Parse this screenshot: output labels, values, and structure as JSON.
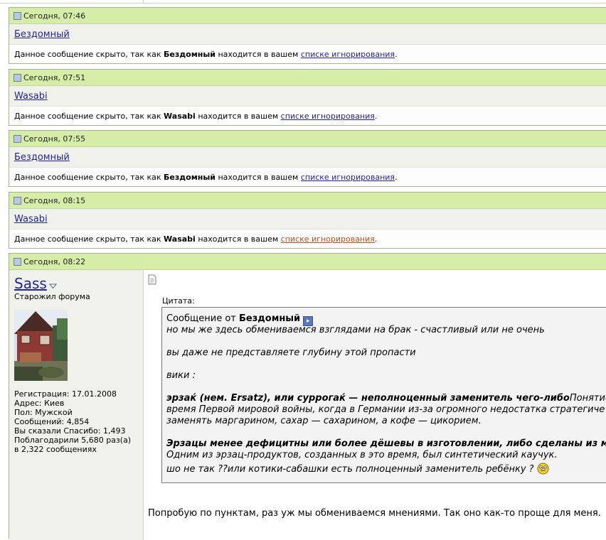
{
  "hidden_posts": [
    {
      "date": "Сегодня, 07:46",
      "username": "Бездомный",
      "msg_prefix": "Данное сообщение скрыто, так как ",
      "msg_user": "Бездомный",
      "msg_mid": " находится в вашем ",
      "ignore_link": "списке игнорирования",
      "msg_end": "."
    },
    {
      "date": "Сегодня, 07:51",
      "username": "Wasabi",
      "msg_prefix": "Данное сообщение скрыто, так как ",
      "msg_user": "Wasabi",
      "msg_mid": " находится в вашем ",
      "ignore_link": "списке игнорирования",
      "msg_end": "."
    },
    {
      "date": "Сегодня, 07:55",
      "username": "Бездомный",
      "msg_prefix": "Данное сообщение скрыто, так как ",
      "msg_user": "Бездомный",
      "msg_mid": " находится в вашем ",
      "ignore_link": "списке игнорирования",
      "msg_end": "."
    },
    {
      "date": "Сегодня, 08:15",
      "username": "Wasabi",
      "msg_prefix": "Данное сообщение скрыто, так как ",
      "msg_user": "Wasabi",
      "msg_mid": " находится в вашем ",
      "ignore_link": "списке игнорирования",
      "msg_end": "."
    }
  ],
  "full_post": {
    "date": "Сегодня, 08:22",
    "author": "Sass",
    "user_title": "Старожил форума",
    "stats": {
      "registration": "Регистрация: 17.01.2008",
      "address": "Адрес: Киев",
      "gender": "Пол: Мужской",
      "messages": "Сообщений: 4,854",
      "thanks_said": "Вы сказали Спасибо: 1,493",
      "thanked_1": "Поблагодарили 5,680 раз(а)",
      "thanked_2": "в 2,322 сообщениях"
    },
    "quote": {
      "label": "Цитата:",
      "from_prefix": "Сообщение от ",
      "from_user": "Бездомный",
      "line1": "но мы же здесь обмениваемся взглядами на брак - счастливый или не очень",
      "line2": "вы даже не представляете глубину этой пропасти",
      "line3": "вики :",
      "line4_bold": "эрзаќ (нем. Ersatz), или суррогаќ — неполноценный заменитель чего-либо",
      "line4_rest": "Понятие",
      "line5": "время Первой мировой войны, когда в Германии из-за огромного недостатка стратегиче",
      "line6": "заменять маргарином, сахар — сахарином, а кофе — цикорием.",
      "line7_bold": "Эрзацы менее дефицитны или более дёшевы в изготовлении, либо сделаны из ма",
      "line8": "Одним из эрзац-продуктов, созданных в это время, был синтетический каучук.",
      "line9": "шо не так ??или котики-сабашки есть полноценный заменитель ребёнку ?"
    },
    "reply": "Попробую по пунктам, раз уж мы обмениваемся мнениями. Так оно как-то проще для меня."
  },
  "colors": {
    "header_bg": "#d6eda8",
    "link": "#22229c",
    "visited_link": "#c2501c",
    "user_col_bg": "#f0f1ea"
  },
  "icons": [
    "post-icon",
    "dropdown-icon",
    "document-icon",
    "view-post-arrow-icon",
    "smiley-icon"
  ]
}
